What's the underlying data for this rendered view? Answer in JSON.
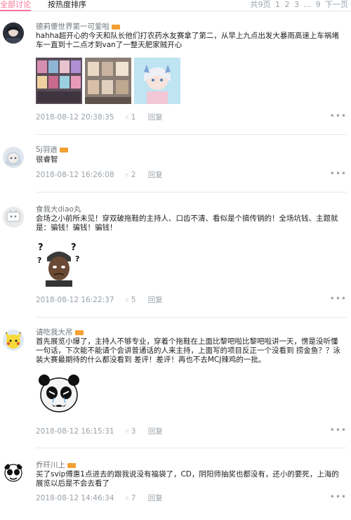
{
  "tabs": {
    "all": "全部讨论",
    "hot": "按热度排序"
  },
  "pager": {
    "total": "共9页",
    "pages": [
      "1",
      "2",
      "3"
    ],
    "ellipsis": "...",
    "last": "9",
    "next": "下一页"
  },
  "comments": [
    {
      "user": "德莉傻世界第一可爱啦",
      "text": "hahha超开心的今天和队长他们打农药水友赛拿了第二，从早上九点出发大暴雨高速上车祸堵车一直到十二点才到van了一整天肥家贼开心",
      "time": "2018-08-12 20:38:35",
      "likes": "1",
      "reply": "回复"
    },
    {
      "user": "Sj羽逍",
      "text": "很睿智",
      "time": "2018-08-12 16:26:08",
      "likes": "2",
      "reply": "回复"
    },
    {
      "user": "食我大diao丸",
      "text": "会场之小前所未见！穿双破拖鞋的主持人、口齿不清、看似是个搞传销的！全场坑钱、主题就是：骗钱！骗钱！骗钱！",
      "time": "2018-08-12 16:22:37",
      "likes": "5",
      "reply": "回复"
    },
    {
      "user": "请吃我大吊",
      "text": "首先展览小爆了，主持人不够专业，穿着个拖鞋在上面比黎吧啦比黎吧啦讲一天，愣是没听懂一句话，下次能不能请个会讲普通话的人来主持，上面写的项目反正一个没看到 捞金鱼？？泳装大赛最期待的什么都没看到 差评！差评！再也不去MCJ辣鸡的一批。",
      "time": "2018-08-12 16:15:31",
      "likes": "3",
      "reply": "回复"
    },
    {
      "user": "乔玕川上",
      "text": "买了svip傅惠1点进去的跟我说没有福袋了，CD，阴阳师抽奖也都没有，还小的要死，上海的展览以后是不会去看了",
      "time": "2018-08-12 14:46:34",
      "likes": "7",
      "reply": "回复"
    }
  ],
  "colors": {
    "accent": "#fb7299",
    "meta": "#99a2aa",
    "name": "#6d757a",
    "level": "#f3a034"
  },
  "icons": {
    "like": "thumbs-up-icon",
    "more": "more-dots-icon"
  }
}
